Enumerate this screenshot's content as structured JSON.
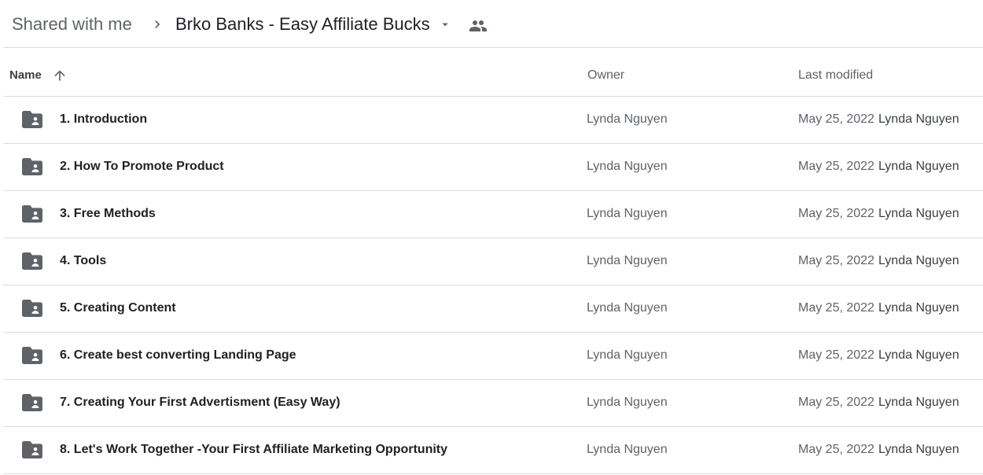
{
  "breadcrumb": {
    "root": "Shared with me",
    "current": "Brko Banks - Easy Affiliate Bucks",
    "separator_icon": "chevron-right-icon",
    "caret_icon": "arrow-drop-down-icon",
    "shared_icon": "people-icon"
  },
  "columns": {
    "name": "Name",
    "owner": "Owner",
    "last_modified": "Last modified",
    "sort_icon": "arrow-up-icon"
  },
  "colors": {
    "folder": "#5f6368",
    "divider": "#dadce0",
    "text_primary": "#202124",
    "text_secondary": "#5f6368"
  },
  "rows": [
    {
      "name": "1. Introduction",
      "owner": "Lynda Nguyen",
      "date": "May 25, 2022",
      "modifier": "Lynda Nguyen",
      "icon": "shared-folder-icon"
    },
    {
      "name": "2. How To Promote Product",
      "owner": "Lynda Nguyen",
      "date": "May 25, 2022",
      "modifier": "Lynda Nguyen",
      "icon": "shared-folder-icon"
    },
    {
      "name": "3. Free Methods",
      "owner": "Lynda Nguyen",
      "date": "May 25, 2022",
      "modifier": "Lynda Nguyen",
      "icon": "shared-folder-icon"
    },
    {
      "name": "4. Tools",
      "owner": "Lynda Nguyen",
      "date": "May 25, 2022",
      "modifier": "Lynda Nguyen",
      "icon": "shared-folder-icon"
    },
    {
      "name": "5. Creating Content",
      "owner": "Lynda Nguyen",
      "date": "May 25, 2022",
      "modifier": "Lynda Nguyen",
      "icon": "shared-folder-icon"
    },
    {
      "name": "6. Create best converting Landing Page",
      "owner": "Lynda Nguyen",
      "date": "May 25, 2022",
      "modifier": "Lynda Nguyen",
      "icon": "shared-folder-icon"
    },
    {
      "name": "7. Creating Your First Advertisment (Easy Way)",
      "owner": "Lynda Nguyen",
      "date": "May 25, 2022",
      "modifier": "Lynda Nguyen",
      "icon": "shared-folder-icon"
    },
    {
      "name": "8. Let's Work Together -Your First Affiliate Marketing Opportunity",
      "owner": "Lynda Nguyen",
      "date": "May 25, 2022",
      "modifier": "Lynda Nguyen",
      "icon": "shared-folder-icon"
    }
  ]
}
